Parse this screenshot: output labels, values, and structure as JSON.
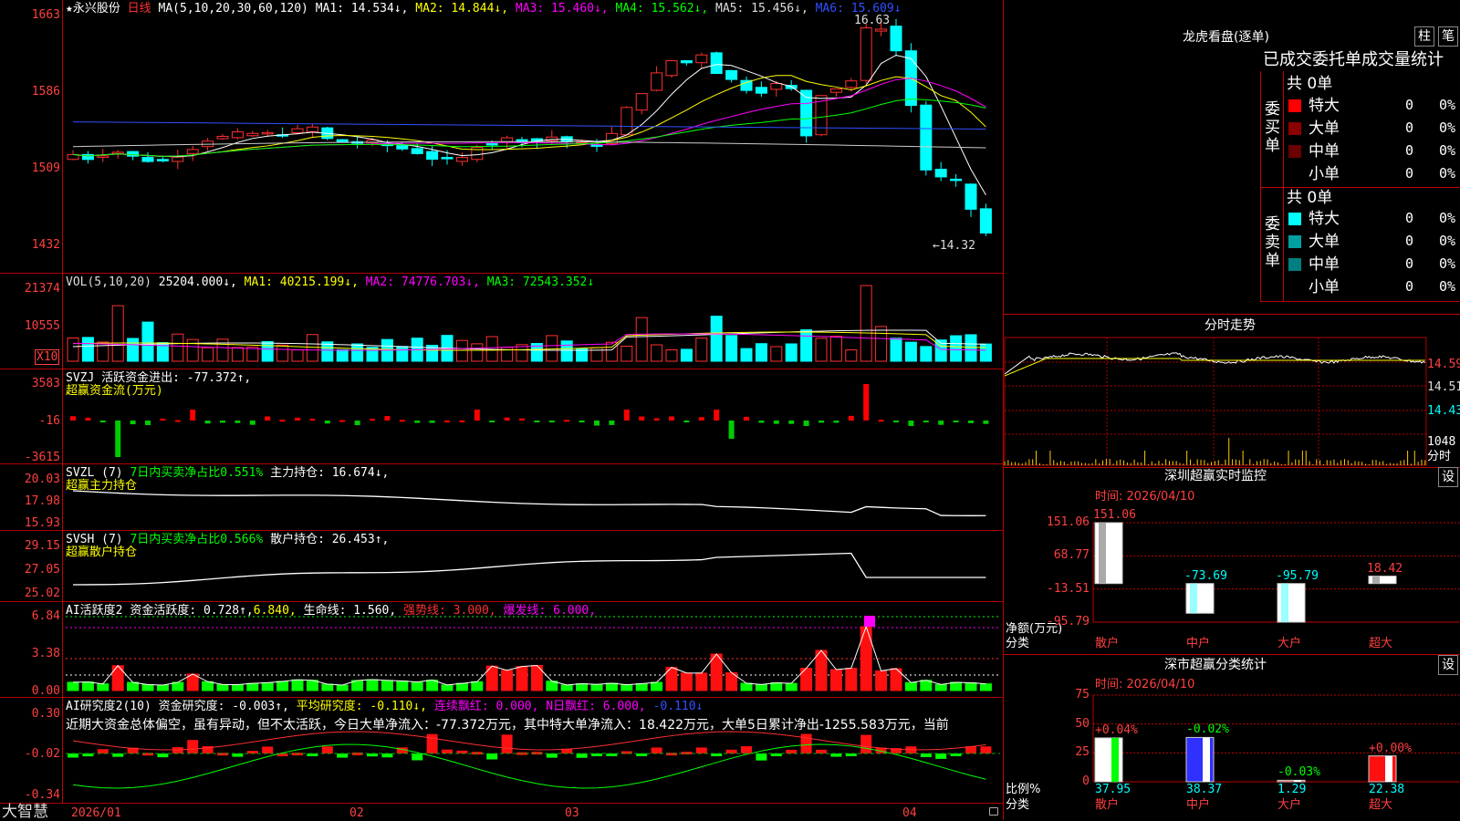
{
  "stock": {
    "star": "★",
    "name": "永兴股份",
    "period": "日线"
  },
  "ma_header": {
    "params": "MA(5,10,20,30,60,120)",
    "ma1": "MA1: 14.534↓,",
    "ma2": "MA2: 14.844↓,",
    "ma3": "MA3: 15.460↓,",
    "ma4": "MA4: 15.562↓,",
    "ma5": "MA5: 15.456↓,",
    "ma6": "MA6: 15.609↓"
  },
  "price_axis": [
    "16.63",
    "15.86",
    "15.09",
    "14.32"
  ],
  "price_axis_labels": [
    "1663",
    "1586",
    "1509",
    "1432"
  ],
  "high_label": "16.63",
  "low_label": "←14.32",
  "vol": {
    "header": "VOL(5,10,20)",
    "value": "25204.000↓,",
    "ma1": "MA1: 40215.199↓,",
    "ma2": "MA2: 74776.703↓,",
    "ma3": "MA3: 72543.352↓",
    "axis": [
      "21374",
      "10555"
    ],
    "unit": "X10"
  },
  "svzj": {
    "header": "SVZJ  活跃资金进出: -77.372↑,",
    "sub": "超赢资金流(万元)",
    "axis": [
      "3583",
      "-16",
      "-3615"
    ]
  },
  "svzl": {
    "header": "SVZL (7)",
    "net": "7日内买卖净占比0.551%",
    "hold": "主力持仓: 16.674↓,",
    "sub": "超赢主力持仓",
    "axis": [
      "20.03",
      "17.98",
      "15.93"
    ]
  },
  "svsh": {
    "header": "SVSH (7)",
    "net": "7日内买卖净占比0.566%",
    "hold": "散户持仓: 26.453↑,",
    "sub": "超赢散户持仓",
    "axis": [
      "29.15",
      "27.05",
      "25.02"
    ]
  },
  "ai_active": {
    "header": "AI活跃度2",
    "a": "资金活跃度: 0.728↑,",
    "b": "6.840,",
    "c": "生命线: 1.560,",
    "d": "强势线: 3.000,",
    "e": "爆发线: 6.000,",
    "axis": [
      "6.84",
      "3.38",
      "0.00"
    ]
  },
  "ai_research": {
    "header": "AI研究度2(10)",
    "a": "资金研究度: -0.003↑,",
    "b": "平均研究度: -0.110↓,",
    "c": "连续飘红: 0.000,",
    "d": "N日飘红: 6.000,",
    "e": "-0.110↓",
    "note": "近期大资金总体偏空，虽有异动，但不太活跃，今日大单净流入：-77.372万元，其中特大单净流入：18.422万元，大单5日累计净出-1255.583万元，当前",
    "axis": [
      "0.30",
      "-0.02",
      "-0.34"
    ]
  },
  "x_axis": [
    "2026/01",
    "02",
    "03",
    "04"
  ],
  "brand": "大智慧",
  "dragon": {
    "title": "龙虎看盘(逐单)",
    "btn1": "柱",
    "btn2": "笔",
    "tabs": "已成交委托单成交量统计",
    "buy": {
      "label": "委买单",
      "total": "共 0单",
      "rows": [
        {
          "name": "特大",
          "n": "0",
          "p": "0%"
        },
        {
          "name": "大单",
          "n": "0",
          "p": "0%"
        },
        {
          "name": "中单",
          "n": "0",
          "p": "0%"
        },
        {
          "name": "小单",
          "n": "0",
          "p": "0%"
        }
      ]
    },
    "sell": {
      "label": "委卖单",
      "total": "共 0单",
      "rows": [
        {
          "name": "特大",
          "n": "0",
          "p": "0%"
        },
        {
          "name": "大单",
          "n": "0",
          "p": "0%"
        },
        {
          "name": "中单",
          "n": "0",
          "p": "0%"
        },
        {
          "name": "小单",
          "n": "0",
          "p": "0%"
        }
      ]
    },
    "colors": {
      "buy": [
        "#ff0000",
        "#8b0000",
        "#6a0000"
      ],
      "sell": [
        "#00ffff",
        "#00a0a0",
        "#008080"
      ]
    }
  },
  "intraday": {
    "title": "分时走势",
    "axis": [
      "14.59",
      "14.51",
      "14.43",
      "1048"
    ],
    "vol_unit": "分时"
  },
  "sz_monitor": {
    "title": "深圳超赢实时监控",
    "set": "设",
    "time": "时间: 2026/04/10",
    "axis": [
      "151.06",
      "68.77",
      "-13.51",
      "-95.79"
    ],
    "ylabel": "净额(万元)",
    "xlabel": "分类",
    "categories": [
      "散户",
      "中户",
      "大户",
      "超大"
    ],
    "values": [
      "151.06",
      "-73.69",
      "-95.79",
      "18.42"
    ]
  },
  "sz_class": {
    "title": "深市超赢分类统计",
    "set": "设",
    "time": "时间: 2026/04/10",
    "axis": [
      "75",
      "50",
      "25",
      "0"
    ],
    "ylabel": "比例%",
    "xlabel": "分类",
    "categories": [
      "散户",
      "中户",
      "大户",
      "超大"
    ],
    "changes": [
      "+0.04%",
      "-0.02%",
      "-0.03%",
      "+0.00%"
    ],
    "values": [
      "37.95",
      "38.37",
      "1.29",
      "22.38"
    ]
  }
}
